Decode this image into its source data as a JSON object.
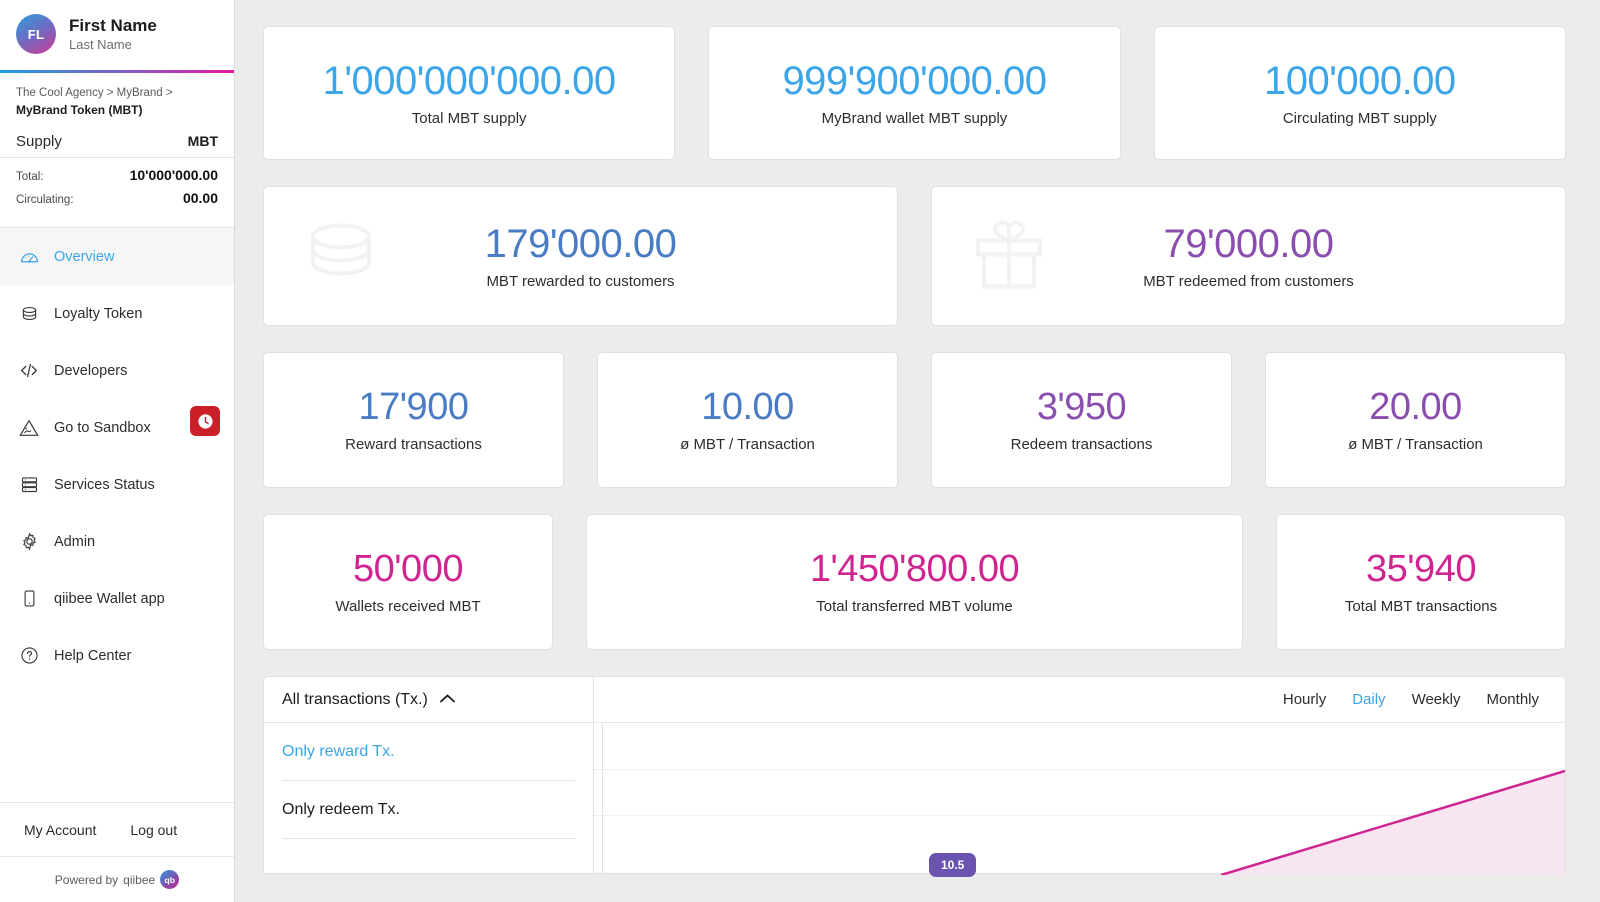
{
  "sidebar": {
    "profile": {
      "initials": "FL",
      "first_name": "First Name",
      "last_name": "Last Name"
    },
    "breadcrumb": {
      "path": "The Cool Agency > MyBrand >",
      "current": "MyBrand Token (MBT)"
    },
    "supply": {
      "title": "Supply",
      "unit": "MBT",
      "rows": [
        {
          "label": "Total:",
          "value": "10'000'000.00"
        },
        {
          "label": "Circulating:",
          "value": "00.00"
        }
      ]
    },
    "nav": [
      {
        "label": "Overview",
        "icon": "gauge-icon",
        "active": true,
        "badge": null
      },
      {
        "label": "Loyalty Token",
        "icon": "coins-icon",
        "active": false,
        "badge": null
      },
      {
        "label": "Developers",
        "icon": "code-icon",
        "active": false,
        "badge": null
      },
      {
        "label": "Go to Sandbox",
        "icon": "warning-sign-icon",
        "active": false,
        "badge": "clock-icon"
      },
      {
        "label": "Services Status",
        "icon": "server-icon",
        "active": false,
        "badge": null
      },
      {
        "label": "Admin",
        "icon": "gear-icon",
        "active": false,
        "badge": null
      },
      {
        "label": "qiibee Wallet app",
        "icon": "phone-icon",
        "active": false,
        "badge": null
      },
      {
        "label": "Help Center",
        "icon": "question-circle-icon",
        "active": false,
        "badge": null
      }
    ],
    "account": {
      "my_account": "My Account",
      "log_out": "Log out"
    },
    "footer": {
      "powered_prefix": "Powered by",
      "brand": "qiibee",
      "mark": "qb"
    }
  },
  "metrics": {
    "row1": [
      {
        "value": "1'000'000'000.00",
        "caption": "Total MBT supply",
        "color": "#3aa5e8"
      },
      {
        "value": "999'900'000.00",
        "caption": "MyBrand wallet MBT supply",
        "color": "#3aa5e8"
      },
      {
        "value": "100'000.00",
        "caption": "Circulating MBT supply",
        "color": "#3aa5e8"
      }
    ],
    "row2": [
      {
        "value": "179'000.00",
        "caption": "MBT rewarded to customers",
        "color": "#4a7cc4",
        "icon": "coins-stack-icon"
      },
      {
        "value": "79'000.00",
        "caption": "MBT redeemed from customers",
        "color": "#8a4fae",
        "icon": "gift-icon"
      }
    ],
    "row3": [
      {
        "value": "17'900",
        "caption": "Reward transactions",
        "color": "#4a7cc4"
      },
      {
        "value": "10.00",
        "caption": "ø MBT / Transaction",
        "color": "#4a7cc4"
      },
      {
        "value": "3'950",
        "caption": "Redeem transactions",
        "color": "#8a4fae"
      },
      {
        "value": "20.00",
        "caption": "ø MBT / Transaction",
        "color": "#8a4fae"
      }
    ],
    "row4": [
      {
        "value": "50'000",
        "caption": "Wallets received MBT",
        "color": "#d02491"
      },
      {
        "value": "1'450'800.00",
        "caption": "Total transferred MBT volume",
        "color": "#d02491"
      },
      {
        "value": "35'940",
        "caption": "Total MBT transactions",
        "color": "#d02491"
      }
    ]
  },
  "panel": {
    "dropdown": {
      "selected": "All transactions (Tx.)",
      "chevron": "chevron-up-icon",
      "options": [
        {
          "label": "Only reward Tx.",
          "selected": true
        },
        {
          "label": "Only redeem Tx.",
          "selected": false
        }
      ]
    },
    "period_tabs": [
      {
        "label": "Hourly",
        "active": false
      },
      {
        "label": "Daily",
        "active": true
      },
      {
        "label": "Weekly",
        "active": false
      },
      {
        "label": "Monthly",
        "active": false
      }
    ],
    "tooltip": {
      "value": "10.5"
    }
  },
  "chart_data": {
    "type": "line",
    "title": "",
    "xlabel": "",
    "ylabel": "",
    "grid": true,
    "legend_position": "none",
    "series": [
      {
        "name": "All transactions (Tx.)",
        "color": "#d02491",
        "x": [
          0,
          1
        ],
        "values": [
          0,
          100
        ]
      }
    ]
  }
}
